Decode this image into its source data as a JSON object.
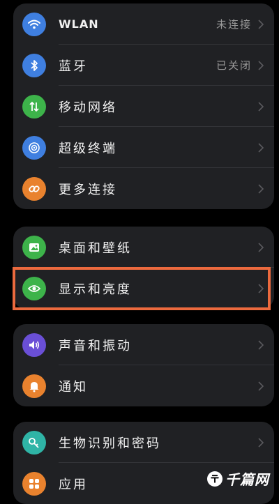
{
  "groups": [
    {
      "items": [
        {
          "label": "WLAN",
          "status": "未连接",
          "icon": "wifi-icon",
          "color": "#3f7fe0"
        },
        {
          "label": "蓝牙",
          "status": "已关闭",
          "icon": "bluetooth-icon",
          "color": "#3f7fe0"
        },
        {
          "label": "移动网络",
          "status": "",
          "icon": "mobile-data-icon",
          "color": "#3db34a"
        },
        {
          "label": "超级终端",
          "status": "",
          "icon": "super-device-icon",
          "color": "#3f7fe0"
        },
        {
          "label": "更多连接",
          "status": "",
          "icon": "link-icon",
          "color": "#e9822e"
        }
      ]
    },
    {
      "items": [
        {
          "label": "桌面和壁纸",
          "status": "",
          "icon": "image-icon",
          "color": "#3db34a"
        },
        {
          "label": "显示和亮度",
          "status": "",
          "icon": "eye-icon",
          "color": "#3db34a"
        }
      ]
    },
    {
      "items": [
        {
          "label": "声音和振动",
          "status": "",
          "icon": "speaker-icon",
          "color": "#6a4fd6"
        },
        {
          "label": "通知",
          "status": "",
          "icon": "bell-icon",
          "color": "#e9822e"
        }
      ]
    },
    {
      "items": [
        {
          "label": "生物识别和密码",
          "status": "",
          "icon": "key-icon",
          "color": "#2fb4a6"
        },
        {
          "label": "应用",
          "status": "",
          "icon": "apps-grid-icon",
          "color": "#e9822e"
        }
      ]
    }
  ],
  "highlight_color": "#ec6a3e",
  "watermark": {
    "text": "千篇网"
  }
}
